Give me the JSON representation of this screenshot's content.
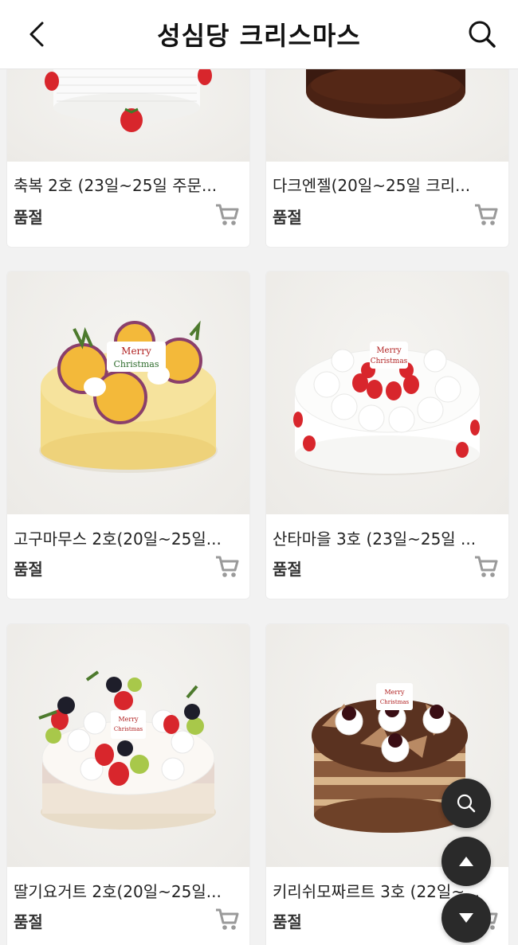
{
  "header": {
    "title": "성심당 크리스마스"
  },
  "products": [
    {
      "name": "축복 2호 (23일~25일 주문...",
      "status": "품절"
    },
    {
      "name": "다크엔젤(20일~25일 크리...",
      "status": "품절"
    },
    {
      "name": "고구마무스 2호(20일~25일...",
      "status": "품절"
    },
    {
      "name": "산타마을 3호 (23일~25일 ...",
      "status": "품절"
    },
    {
      "name": "딸기요거트 2호(20일~25일...",
      "status": "품절"
    },
    {
      "name": "키리쉬모짜르트 3호 (22일~...",
      "status": "품절"
    }
  ],
  "cake_toppers": {
    "merry": "Merry",
    "christmas": "Christmas"
  },
  "colors": {
    "header_bg": "#ffffff",
    "fab_bg": "#2a2a2a",
    "cart_icon": "#9a9a9a",
    "strawberry": "#d8262c"
  }
}
